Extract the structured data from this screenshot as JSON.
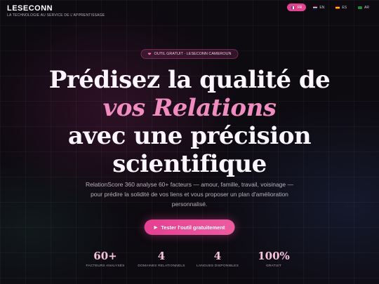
{
  "brand": {
    "name": "LESECONN",
    "tagline": "LA TECHNOLOGIE AU SERVICE DE L'APPRENTISSAGE"
  },
  "languages": [
    {
      "code": "FR",
      "flag": "flag-fr",
      "active": true
    },
    {
      "code": "EN",
      "flag": "flag-en",
      "active": false
    },
    {
      "code": "ES",
      "flag": "flag-es",
      "active": false
    },
    {
      "code": "AR",
      "flag": "flag-ar",
      "active": false
    }
  ],
  "badge": {
    "icon": "heart-icon",
    "text": "OUTIL GRATUIT · LESECONN CAMEROUN"
  },
  "hero": {
    "line1": "Prédisez la qualité de",
    "line2": "vos Relations",
    "line3": "avec une précision",
    "line4": "scientifique",
    "subtitle": "RelationScore 360 analyse 60+ facteurs — amour, famille, travail, voisinage — pour prédire la solidité de vos liens et vous proposer un plan d'amélioration personnalisé.",
    "cta_label": "Tester l'outil gratuitement"
  },
  "stats": [
    {
      "value": "60+",
      "label": "FACTEURS ANALYSÉS"
    },
    {
      "value": "4",
      "label": "DOMAINES RELATIONNELS"
    },
    {
      "value": "4",
      "label": "LANGUES DISPONIBLES"
    },
    {
      "value": "100%",
      "label": "GRATUIT"
    }
  ],
  "colors": {
    "accent": "#e3448f",
    "accent_text": "#f08cc0",
    "background": "#0d0a10"
  }
}
